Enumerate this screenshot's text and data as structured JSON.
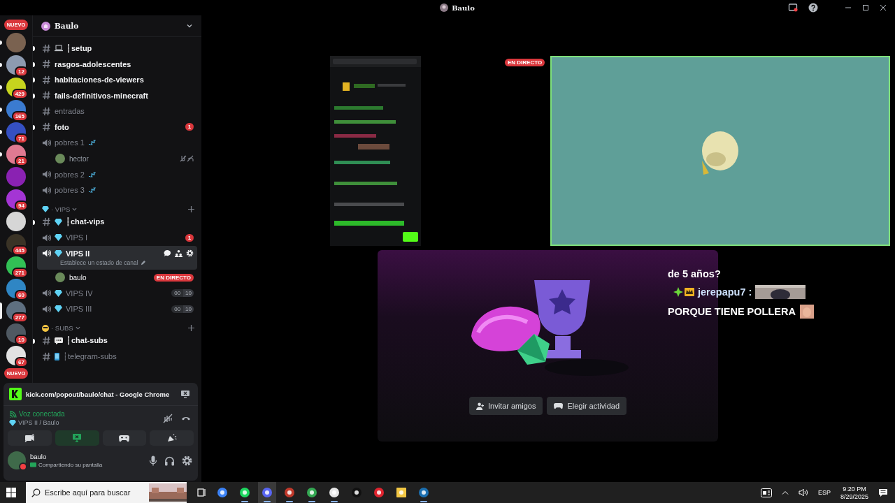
{
  "window": {
    "title": "Baulo"
  },
  "rail": [
    {
      "kind": "new",
      "label": "NUEVO"
    },
    {
      "kind": "server",
      "unread": true,
      "selected": false,
      "color": "#7a6250"
    },
    {
      "kind": "server",
      "badge": "12",
      "unread": true,
      "selected": false,
      "color": "#8d9bb0"
    },
    {
      "kind": "server",
      "badge": "429",
      "unread": true,
      "selected": false,
      "color": "#c6d41e"
    },
    {
      "kind": "server",
      "badge": "165",
      "unread": true,
      "selected": false,
      "color": "#3b7bd0"
    },
    {
      "kind": "server",
      "badge": "71",
      "unread": true,
      "selected": false,
      "color": "#3550c2"
    },
    {
      "kind": "server",
      "badge": "21",
      "unread": true,
      "selected": false,
      "color": "#e07a92"
    },
    {
      "kind": "server",
      "unread": false,
      "selected": false,
      "color": "#8a22b2"
    },
    {
      "kind": "server",
      "badge": "94",
      "unread": false,
      "selected": false,
      "color": "#a435d4"
    },
    {
      "kind": "server",
      "unread": false,
      "selected": false,
      "color": "#d6d6d6"
    },
    {
      "kind": "server",
      "badge": "445",
      "unread": false,
      "selected": false,
      "color": "#3a3326"
    },
    {
      "kind": "server",
      "badge": "271",
      "unread": false,
      "selected": false,
      "color": "#32c055"
    },
    {
      "kind": "server",
      "badge": "60",
      "unread": false,
      "selected": false,
      "color": "#2f86c4"
    },
    {
      "kind": "server",
      "badge": "277",
      "unread": false,
      "selected": true,
      "color": "#5e6f80"
    },
    {
      "kind": "server",
      "badge": "10",
      "unread": false,
      "selected": false,
      "color": "#4f5962"
    },
    {
      "kind": "server",
      "badge": "67",
      "unread": false,
      "selected": false,
      "color": "#e2e2e2"
    },
    {
      "kind": "new",
      "label": "NUEVO"
    }
  ],
  "channel_list": {
    "header": "Baulo",
    "items": [
      {
        "kind": "text",
        "name": "┆setup",
        "emoji": {
          "kind": "laptop"
        },
        "unread": true,
        "selected": false
      },
      {
        "kind": "text",
        "name": "rasgos-adolescentes",
        "unread": true,
        "selected": false
      },
      {
        "kind": "text",
        "name": "habitaciones-de-viewers",
        "unread": true,
        "selected": false
      },
      {
        "kind": "text",
        "name": "fails-definitivos-minecraft",
        "unread": true,
        "selected": false
      },
      {
        "kind": "text",
        "name": "entradas",
        "unread": false,
        "selected": false
      },
      {
        "kind": "text",
        "name": "foto",
        "unread": true,
        "selected": false,
        "badge": "1"
      },
      {
        "kind": "voice",
        "name": "pobres 1",
        "unread": false,
        "selected": false,
        "sleeping": true,
        "children": [
          {
            "name": "hector"
          }
        ]
      },
      {
        "kind": "voice",
        "name": "pobres 2",
        "unread": false,
        "selected": false,
        "sleeping": true
      },
      {
        "kind": "voice",
        "name": "pobres 3",
        "unread": false,
        "selected": false,
        "sleeping": true
      },
      {
        "kind": "category",
        "name": "· VIPS",
        "emoji": {
          "kind": "diamond"
        },
        "children": [
          {
            "kind": "text",
            "name": "┆chat-vips",
            "emoji": {
              "kind": "diamond"
            },
            "unread": true,
            "selected": false
          },
          {
            "kind": "voice",
            "name": "VIPS I",
            "emoji": {
              "kind": "diamond"
            },
            "unread": false,
            "selected": false,
            "badge": "1"
          },
          {
            "kind": "voice",
            "name": "VIPS II",
            "emoji": {
              "kind": "diamond"
            },
            "unread": true,
            "selected": true,
            "status": "Establece un estado de canal",
            "children": [
              {
                "name": "baulo",
                "live_badge": "EN DIRECTO"
              }
            ]
          },
          {
            "kind": "voice",
            "name": "VIPS IV",
            "emoji": {
              "kind": "diamond"
            },
            "unread": false,
            "selected": false,
            "user_limit": [
              "00",
              "10"
            ]
          },
          {
            "kind": "voice",
            "name": "VIPS III",
            "emoji": {
              "kind": "diamond"
            },
            "unread": false,
            "selected": false,
            "user_limit": [
              "00",
              "10"
            ]
          }
        ]
      },
      {
        "kind": "category",
        "name": "· SUBS",
        "emoji": {
          "kind": "face"
        },
        "children": [
          {
            "kind": "text",
            "name": "┆chat-subs",
            "emoji": {
              "kind": "speech"
            },
            "unread": true,
            "selected": false
          },
          {
            "kind": "text",
            "name": "┆telegram-subs",
            "emoji": {
              "kind": "phone"
            },
            "unread": false,
            "selected": false
          }
        ]
      }
    ]
  },
  "stream_card": {
    "title": "kick.com/popout/baulo/chat - Google Chrome"
  },
  "voice_status": {
    "status": "Voz conectada",
    "channel": "VIPS II / Baulo"
  },
  "voice_buttons": [
    {
      "kind": "camera-off",
      "selected": false
    },
    {
      "kind": "screen",
      "selected": true
    },
    {
      "kind": "activity",
      "selected": false
    },
    {
      "kind": "soundboard",
      "selected": false
    }
  ],
  "user": {
    "name": "baulo",
    "status": "Compartiendo su pantalla"
  },
  "stream": {
    "live_badge": "EN DIRECTO",
    "overlay_chat": [
      {
        "kind": "text",
        "text": "de 5 años?"
      },
      {
        "kind": "user",
        "text": "jerepapu7 :"
      },
      {
        "kind": "text",
        "text": "PORQUE TIENE POLLERA"
      }
    ],
    "buttons": [
      {
        "kind": "invite",
        "label": "Invitar amigos"
      },
      {
        "kind": "activity",
        "label": "Elegir actividad"
      }
    ]
  },
  "taskbar": {
    "search": {
      "placeholder": "Escribe aquí para buscar"
    },
    "apps": [
      {
        "kind": "copilot",
        "running": false
      },
      {
        "kind": "spotify",
        "running": true
      },
      {
        "kind": "discord",
        "running": true
      },
      {
        "kind": "voicemeeter",
        "running": true
      },
      {
        "kind": "chrome",
        "running": true
      },
      {
        "kind": "obs",
        "running": true
      },
      {
        "kind": "capcut",
        "running": false
      },
      {
        "kind": "opera",
        "running": false
      },
      {
        "kind": "files",
        "running": false
      },
      {
        "kind": "steam",
        "running": true
      }
    ],
    "language": "ESP",
    "time": "9:20 PM",
    "date": "8/29/2025"
  }
}
